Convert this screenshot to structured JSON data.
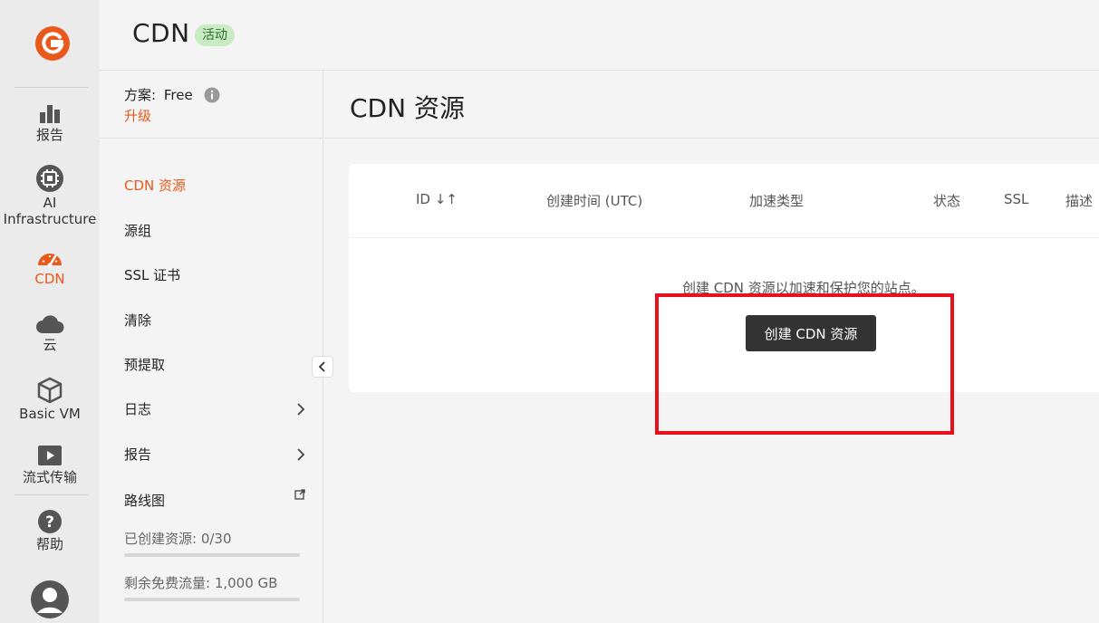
{
  "rail": {
    "items": [
      {
        "label": "报告",
        "icon": "bar-chart-icon"
      },
      {
        "label": "AI Infrastructure",
        "icon": "chip-icon"
      },
      {
        "label": "CDN",
        "icon": "speedometer-icon",
        "active": true
      },
      {
        "label": "云",
        "icon": "cloud-icon"
      },
      {
        "label": "Basic VM",
        "icon": "cube-icon"
      },
      {
        "label": "流式传输",
        "icon": "play-icon"
      },
      {
        "label": "帮助",
        "icon": "help-icon"
      }
    ],
    "avatar_icon": "user-avatar-icon",
    "logo_icon": "gcore-logo-icon"
  },
  "header": {
    "title": "CDN",
    "status_badge": "活动"
  },
  "sidebar": {
    "plan_label": "方案:",
    "plan_value": "Free",
    "upgrade_label": "升级",
    "items": [
      {
        "label": "CDN 资源",
        "active": true
      },
      {
        "label": "源组"
      },
      {
        "label": "SSL 证书"
      },
      {
        "label": "清除"
      },
      {
        "label": "预提取"
      },
      {
        "label": "日志",
        "has_chevron": true
      },
      {
        "label": "报告",
        "has_chevron": true
      },
      {
        "label": "路线图",
        "external": true
      }
    ],
    "usage": {
      "resources_label": "已创建资源: 0/30",
      "resources_fraction": 0,
      "traffic_label": "剩余免费流量: 1,000 GB"
    }
  },
  "main": {
    "page_title": "CDN 资源",
    "table": {
      "columns": [
        "ID ↓↑",
        "创建时间 (UTC)",
        "加速类型",
        "状态",
        "SSL",
        "描述"
      ]
    },
    "empty_message": "创建 CDN 资源以加速和保护您的站点。",
    "create_button": "创建 CDN 资源"
  },
  "colors": {
    "accent": "#e8591b",
    "badge_bg": "#c9ebc3",
    "badge_text": "#2f6e2a",
    "highlight": "#e8101a",
    "button_bg": "#333333"
  }
}
